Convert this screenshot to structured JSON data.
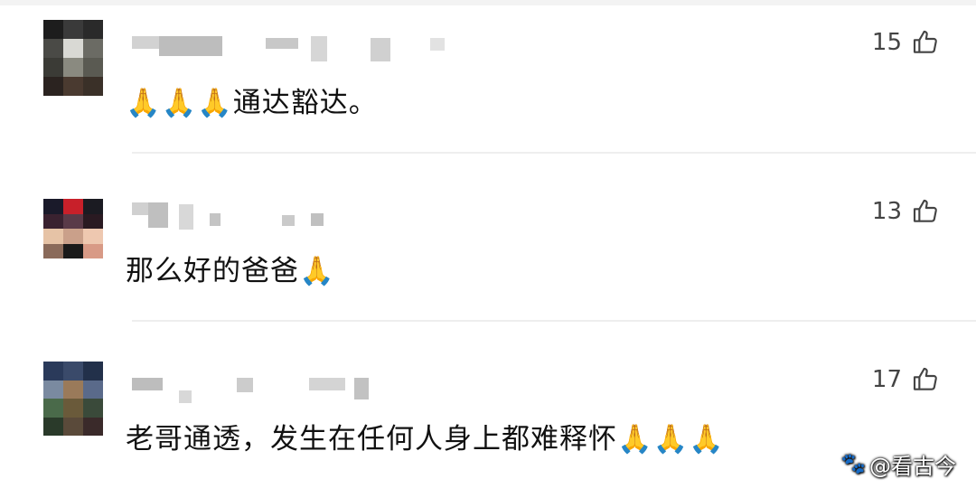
{
  "comments": [
    {
      "text": "🙏🙏🙏通达豁达。",
      "likes": "15"
    },
    {
      "text": "那么好的爸爸🙏",
      "likes": "13"
    },
    {
      "text": "老哥通透，发生在任何人身上都难释怀🙏🙏🙏",
      "likes": "17"
    }
  ],
  "watermark": {
    "logo": "🐾",
    "text": "@看古今"
  },
  "icons": {
    "like": "thumbs-up-icon",
    "avatar": "pixelated-avatar",
    "username": "pixelated-username"
  }
}
